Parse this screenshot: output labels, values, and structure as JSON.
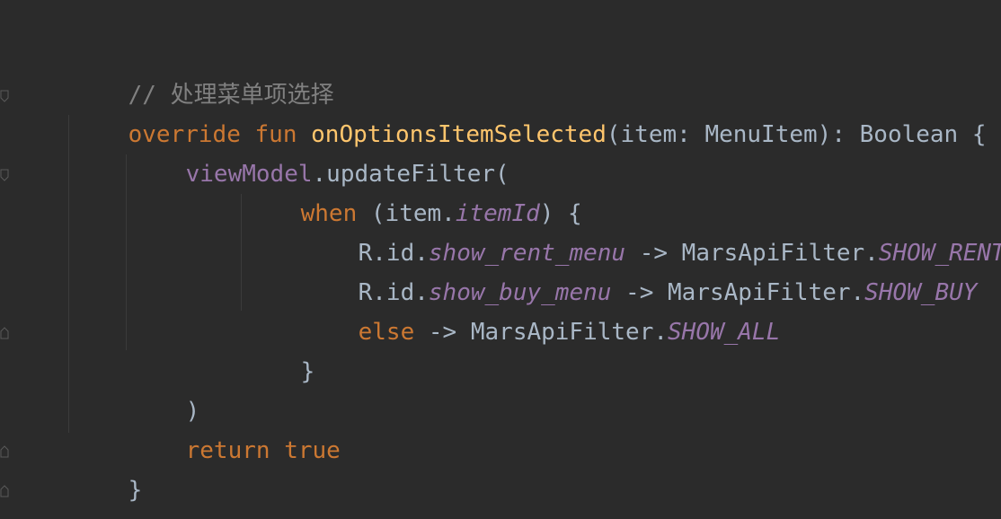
{
  "code": {
    "line1": {
      "comment": "// 处理菜单项选择"
    },
    "line2": {
      "kw_override": "override",
      "kw_fun": "fun",
      "fn_name": "onOptionsItemSelected",
      "params": "(item: MenuItem): Boolean {"
    },
    "line3": {
      "receiver": "viewModel",
      "call": ".updateFilter("
    },
    "line4": {
      "kw_when": "when",
      "open": " (item.",
      "prop": "itemId",
      "close": ") {"
    },
    "line5": {
      "prefix": "R.id.",
      "menu_id": "show_rent_menu",
      "arrow": " -> MarsApiFilter.",
      "constant": "SHOW_RENT"
    },
    "line6": {
      "prefix": "R.id.",
      "menu_id": "show_buy_menu",
      "arrow": " -> MarsApiFilter.",
      "constant": "SHOW_BUY"
    },
    "line7": {
      "kw_else": "else",
      "arrow": " -> MarsApiFilter.",
      "constant": "SHOW_ALL"
    },
    "line8": {
      "brace": "}"
    },
    "line9": {
      "paren": ")"
    },
    "line10": {
      "kw_return": "return",
      "kw_true": "true"
    },
    "line11": {
      "brace": "}"
    },
    "line12": {
      "brace": "}"
    }
  },
  "colors": {
    "background": "#2b2b2b",
    "keyword": "#cc7832",
    "function": "#ffc66d",
    "property": "#9876aa",
    "comment": "#808080",
    "plain": "#a9b7c6"
  }
}
